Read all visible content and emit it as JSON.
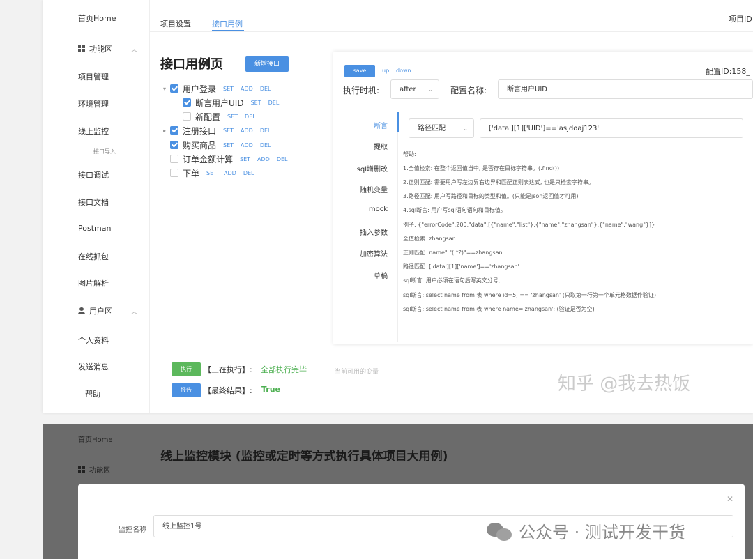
{
  "sidebar": {
    "home": "首页Home",
    "func_zone": "功能区",
    "items": [
      "项目管理",
      "环境管理",
      "线上监控",
      "接口导入",
      "接口调试",
      "接口文档",
      "Postman",
      "在线抓包",
      "图片解析"
    ],
    "user_zone": "用户区",
    "user_items": [
      "个人资料",
      "发送消息",
      "帮助"
    ]
  },
  "tabs": [
    "项目设置",
    "接口用例"
  ],
  "project_id_label": "项目ID",
  "page_title": "接口用例页",
  "new_button": "新增接口",
  "tree": [
    {
      "label": "用户登录",
      "checked": true,
      "actions": [
        "SET",
        "ADD",
        "DEL"
      ]
    },
    {
      "label": "断言用户UID",
      "checked": true,
      "actions": [
        "SET",
        "DEL"
      ]
    },
    {
      "label": "新配置",
      "checked": false,
      "actions": [
        "SET",
        "DEL"
      ]
    },
    {
      "label": "注册接口",
      "checked": true,
      "actions": [
        "SET",
        "ADD",
        "DEL"
      ]
    },
    {
      "label": "购买商品",
      "checked": true,
      "actions": [
        "SET",
        "ADD",
        "DEL"
      ]
    },
    {
      "label": "订单金额计算",
      "checked": false,
      "actions": [
        "SET",
        "ADD",
        "DEL"
      ]
    },
    {
      "label": "下单",
      "checked": false,
      "actions": [
        "SET",
        "ADD",
        "DEL"
      ]
    }
  ],
  "panel": {
    "save": "save",
    "up": "up",
    "down": "down",
    "config_id": "配置ID:158_",
    "exec_time_label": "执行时机:",
    "exec_time_value": "after",
    "config_name_label": "配置名称:",
    "config_name_value": "断言用户UID",
    "menu": [
      "断言",
      "提取",
      "sql增删改",
      "随机变量",
      "mock",
      "插入参数",
      "加密算法",
      "草稿"
    ],
    "assert_type": "路径匹配",
    "assert_expr": "['data'][1]['UID']=='asjdoaj123'",
    "help": [
      "帮助:",
      "1.全值检索: 在整个返回值当中, 是否存在目标字符串。(.find())",
      "2.正则匹配: 需要用户写左边界右边界和匹配正则表达式, 也是只检索字符串。",
      "3.路径匹配: 用户写路径和目标的类型和值。(只能是json返回值才可用)",
      "4.sql断言: 用户写sql语句语句和目标值。",
      "例子: {\"errorCode\":200,\"data\":[{\"name\":\"list\"},{\"name\":\"zhangsan\"},{\"name\":\"wang\"}]}",
      "全值检索: zhangsan",
      "正则匹配: name\":\"(.*?)\"==zhangsan",
      "路径匹配: ['data'][1]['name']=='zhangsan'",
      "sql断言: 用户必须在语句后写英文分号;",
      "sql断言: select name from 表 where id=5; == 'zhangsan' (只取第一行第一个单元格数据作验证)",
      "sql断言: select name from 表 where name='zhangsan'; (验证是否为空)"
    ]
  },
  "bottom": {
    "run_button": "执行",
    "run_label": "【工在执行】:",
    "run_status": "全部执行完毕",
    "report_button": "报告",
    "result_label": "【最终结果】:",
    "result_value": "True",
    "placeholder": "当前可用的变量"
  },
  "watermark1": "知乎 @我去热饭",
  "second": {
    "home": "首页Home",
    "func_zone": "功能区",
    "title": "线上监控模块 (监控或定时等方式执行具体项目大用例)",
    "modal_label": "监控名称",
    "modal_value": "线上监控1号"
  },
  "watermark2": "公众号 · 测试开发干货",
  "colors": {
    "accent": "#4a90e2",
    "success": "#5cb85c",
    "green_text": "#4caf50"
  }
}
